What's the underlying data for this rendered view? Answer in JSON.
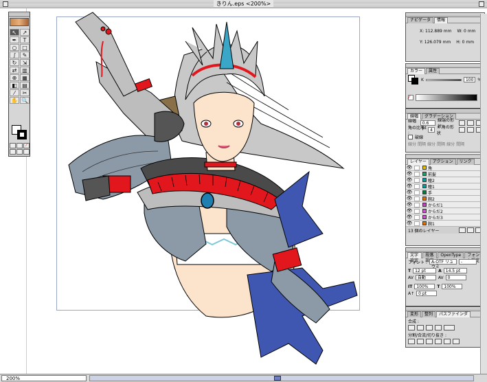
{
  "window": {
    "title": "きりん.eps <200%>"
  },
  "status": {
    "zoom": "200%"
  },
  "toolbox": {
    "tools": [
      "↖",
      "↗",
      "✒",
      "T",
      "○",
      "□",
      "∫",
      "✎",
      "↻",
      "⇲",
      "⇄",
      "▥",
      "⊕",
      "▦",
      "◧",
      "▤",
      "⁄",
      "✂",
      "✋",
      "🔍"
    ]
  },
  "navigator": {
    "tabs": [
      "ナビゲータ",
      "情報"
    ],
    "x": "X: 112.889 mm",
    "y": "Y: 126.079 mm",
    "w": "W: 0 mm",
    "h": "H: 0 mm"
  },
  "color": {
    "tabs": [
      "カラー",
      "属性"
    ],
    "k_label": "K",
    "k_value": "100",
    "percent": "%"
  },
  "stroke": {
    "tabs": [
      "線幅",
      "グラデーション"
    ],
    "weight_label": "線幅 :",
    "weight_value": "0.6 pt",
    "cap_label": "線端の形状",
    "miter_label": "角の比率 :",
    "miter_value": "4",
    "join_label": "× 角の形状",
    "dash_label": "破線",
    "dash_cols": [
      "線分",
      "間隔",
      "線分",
      "間隔",
      "線分",
      "間隔"
    ]
  },
  "layers": {
    "tabs": [
      "レイヤー",
      "アクション",
      "リンク"
    ],
    "items": [
      {
        "name": "角",
        "color": "#e8c200"
      },
      {
        "name": "前髪",
        "color": "#1fa06a"
      },
      {
        "name": "瞳2",
        "color": "#00a0a0"
      },
      {
        "name": "瞳1",
        "color": "#00a0a0"
      },
      {
        "name": "手",
        "color": "#008040"
      },
      {
        "name": "腕2",
        "color": "#e07000"
      },
      {
        "name": "からだ1",
        "color": "#c040c0"
      },
      {
        "name": "からだ2",
        "color": "#d050d0"
      },
      {
        "name": "からだ3",
        "color": "#d050d0"
      },
      {
        "name": "腕1",
        "color": "#e07000"
      }
    ],
    "footer": "13 個のレイヤー"
  },
  "character": {
    "tabs": [
      "文字設定",
      "段落設定",
      "OpenType",
      "フォント設定"
    ],
    "font_label": "フォント :",
    "font_value": "A-OTF リュウミ",
    "font_style": "-",
    "size": "12 pt",
    "leading": "14.5 pt",
    "tracking_mode": "自動",
    "kerning": "0",
    "vscale": "100%",
    "hscale": "100%",
    "baseline": "0 pt"
  },
  "pathfinder": {
    "tabs": [
      "変形",
      "整列",
      "パスファインダ"
    ],
    "combine_label": "合成 :",
    "divide_label": "分割/合流/切り抜き :"
  },
  "colors": {
    "skin": "#fbe3cc",
    "hair": "#c8c8c8",
    "fur": "#bdbdbd",
    "armor": "#8c9aa8",
    "red": "#e2161d",
    "blue": "#3f57b0",
    "dark": "#4a4a4a",
    "horn": "#3aa7c9"
  }
}
